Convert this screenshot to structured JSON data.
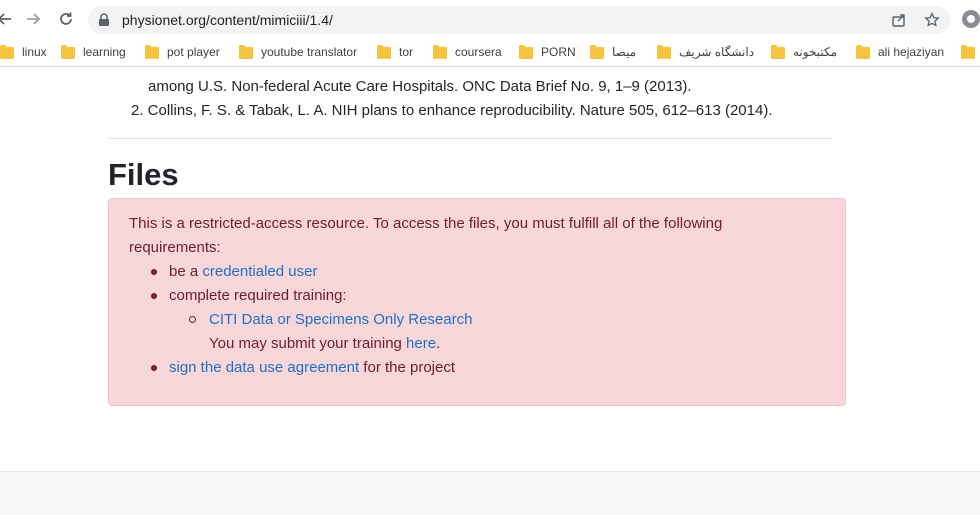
{
  "browser": {
    "url": "physionet.org/content/mimiciii/1.4/",
    "bookmarks": [
      {
        "label": "linux"
      },
      {
        "label": "learning"
      },
      {
        "label": "pot player"
      },
      {
        "label": "youtube translator"
      },
      {
        "label": "tor"
      },
      {
        "label": "coursera"
      },
      {
        "label": "PORN"
      },
      {
        "label": "میصا"
      },
      {
        "label": "دانشگاه شریف"
      },
      {
        "label": "مکتبخونه"
      },
      {
        "label": "ali hejaziyan"
      }
    ]
  },
  "page": {
    "references": {
      "item1_continuation": "among U.S. Non-federal Acute Care Hospitals. ONC Data Brief No. 9, 1–9 (2013).",
      "item2": "2. Collins, F. S. & Tabak, L. A. NIH plans to enhance reproducibility. Nature 505, 612–613 (2014)."
    },
    "files_heading": "Files",
    "alert": {
      "intro_line1": "This is a restricted-access resource. To access the files, you must fulfill all of the following",
      "intro_line2": "requirements:",
      "req1_prefix": "be a ",
      "req1_link": "credentialed user",
      "req2": "complete required training:",
      "training_link": "CITI Data or Specimens Only Research",
      "submit_prefix": "You may submit your training ",
      "submit_link": "here",
      "submit_suffix": ".",
      "req3_link": "sign the data use agreement",
      "req3_suffix": " for the project"
    }
  }
}
